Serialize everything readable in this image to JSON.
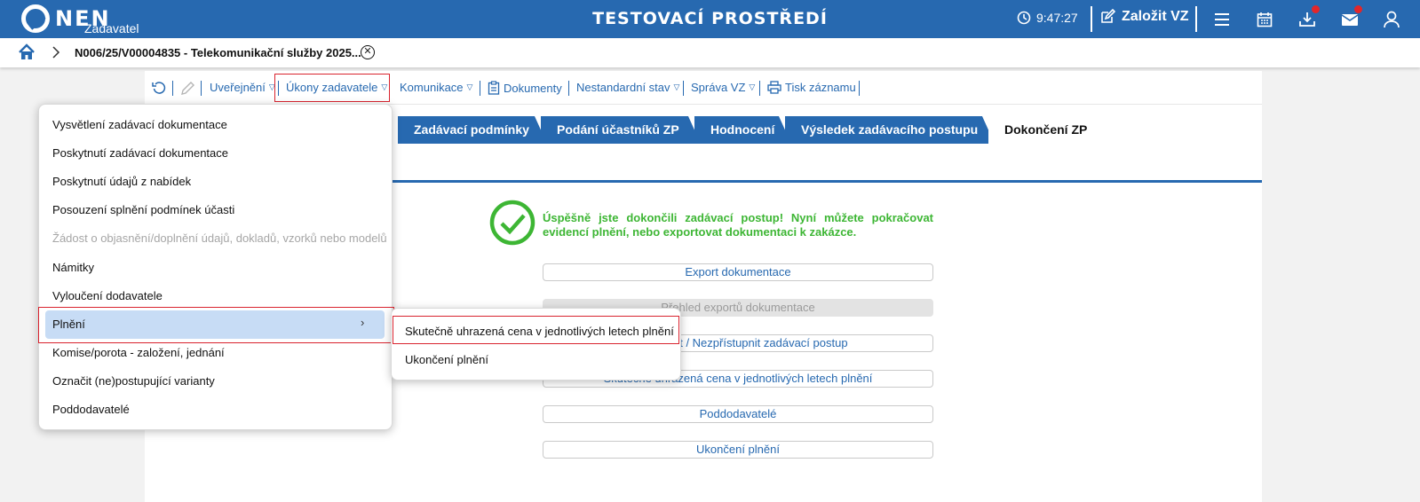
{
  "header": {
    "logo_text": "NEN",
    "logo_sub": "Zadavatel",
    "env_title": "TESTOVACÍ PROSTŘEDÍ",
    "clock": "9:47:27",
    "create_label": "Založit VZ",
    "brand_color": "#2769b0",
    "notification_color": "#e3262a"
  },
  "breadcrumb": {
    "current": "N006/25/V00004835 - Telekomunikační služby 2025..."
  },
  "toolbar": {
    "publish": "Uveřejnění",
    "actions": "Úkony zadavatele",
    "communication": "Komunikace",
    "documents": "Dokumenty",
    "nonstandard": "Nestandardní stav",
    "management": "Správa VZ",
    "print": "Tisk záznamu"
  },
  "tabs": [
    {
      "label": "Zadávací podmínky"
    },
    {
      "label": "Podání účastníků ZP"
    },
    {
      "label": "Hodnocení"
    },
    {
      "label": "Výsledek zadávacího postupu"
    },
    {
      "label": "Dokončení ZP"
    }
  ],
  "main": {
    "success_message": "Úspěšně jste dokončili zadávací postup! Nyní můžete pokračovat evidencí plnění, nebo exportovat dokumentaci k zakázce.",
    "success_color": "#3db634",
    "buttons": [
      {
        "label": "Export dokumentace",
        "enabled": true
      },
      {
        "label": "Přehled exportů dokumentace",
        "enabled": false
      },
      {
        "label": "Zpřístupnit / Nezpřístupnit zadávací postup",
        "enabled": true
      },
      {
        "label": "Skutečně uhrazená cena v jednotlivých letech plnění",
        "enabled": true
      },
      {
        "label": "Poddodavatelé",
        "enabled": true
      },
      {
        "label": "Ukončení plnění",
        "enabled": true
      }
    ]
  },
  "dropdown": {
    "items": [
      {
        "label": "Vysvětlení zadávací dokumentace",
        "enabled": true
      },
      {
        "label": "Poskytnutí zadávací dokumentace",
        "enabled": true
      },
      {
        "label": "Poskytnutí údajů z nabídek",
        "enabled": true
      },
      {
        "label": "Posouzení splnění podmínek účasti",
        "enabled": true
      },
      {
        "label": "Žádost o objasnění/doplnění údajů, dokladů, vzorků nebo modelů",
        "enabled": false
      },
      {
        "label": "Námitky",
        "enabled": true
      },
      {
        "label": "Vyloučení dodavatele",
        "enabled": true
      },
      {
        "label": "Plnění",
        "enabled": true,
        "selected": true
      },
      {
        "label": "Komise/porota - založení, jednání",
        "enabled": true
      },
      {
        "label": "Označit (ne)postupující varianty",
        "enabled": true
      },
      {
        "label": "Poddodavatelé",
        "enabled": true
      }
    ]
  },
  "submenu": {
    "items": [
      {
        "label": "Skutečně uhrazená cena v jednotlivých letech plnění"
      },
      {
        "label": "Ukončení plnění"
      }
    ]
  }
}
